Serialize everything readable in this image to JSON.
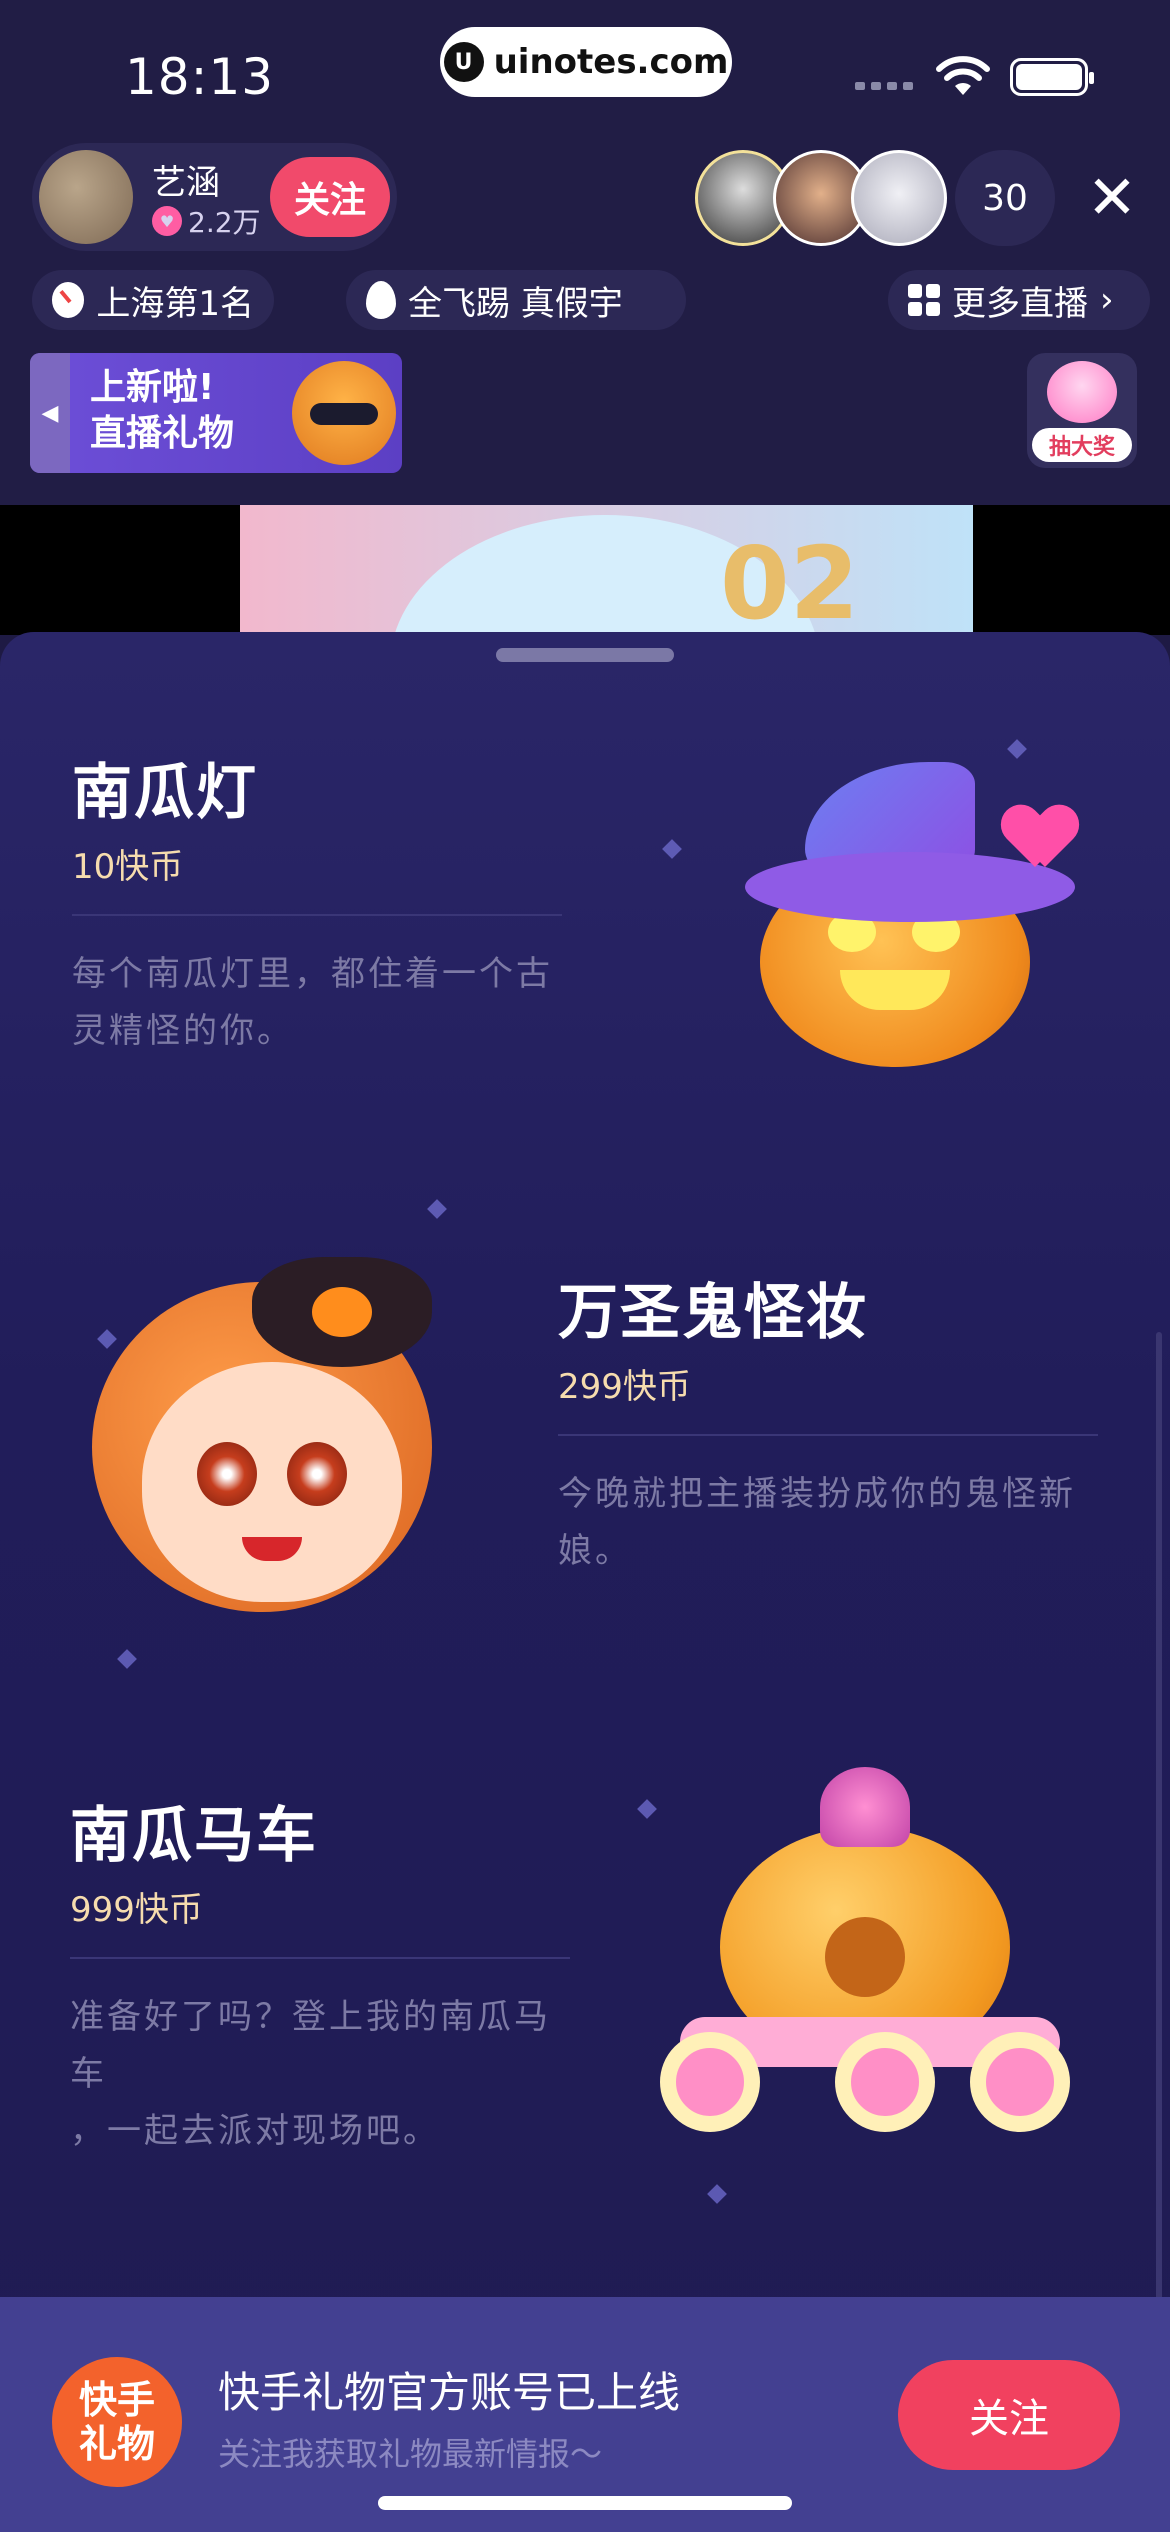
{
  "status_bar": {
    "time": "18:13",
    "watermark": "uinotes.com"
  },
  "host": {
    "name": "艺涵",
    "fans": "2.2万",
    "follow_label": "关注"
  },
  "viewers": {
    "count": "30"
  },
  "tags": {
    "rank": "上海第1名",
    "topics": "全飞踢   真假宇",
    "more": "更多直播"
  },
  "banner": {
    "line1": "上新啦!",
    "line2": "直播礼物"
  },
  "lottery": {
    "label": "抽大奖"
  },
  "video": {
    "number": "02"
  },
  "gifts": [
    {
      "name": "南瓜灯",
      "price": "10快币",
      "desc_line1": "每个南瓜灯里，都住着一个古",
      "desc_line2": "灵精怪的你。",
      "image": "pumpkin-lantern"
    },
    {
      "name": "万圣鬼怪妆",
      "price": "299快币",
      "desc_line1": "今晚就把主播装扮成你的鬼怪新",
      "desc_line2": "娘。",
      "image": "halloween-makeup-girl"
    },
    {
      "name": "南瓜马车",
      "price": "999快币",
      "desc_line1": "准备好了吗？登上我的南瓜马车",
      "desc_line2": "，一起去派对现场吧。",
      "image": "pumpkin-carriage"
    }
  ],
  "account_bar": {
    "logo_line1": "快手",
    "logo_line2": "礼物",
    "title": "快手礼物官方账号已上线",
    "subtitle": "关注我获取礼物最新情报～",
    "follow_label": "关注"
  },
  "colors": {
    "accent_pink": "#f1415f",
    "sheet_bg": "#211d5a",
    "price_gold": "#f6dcae"
  }
}
